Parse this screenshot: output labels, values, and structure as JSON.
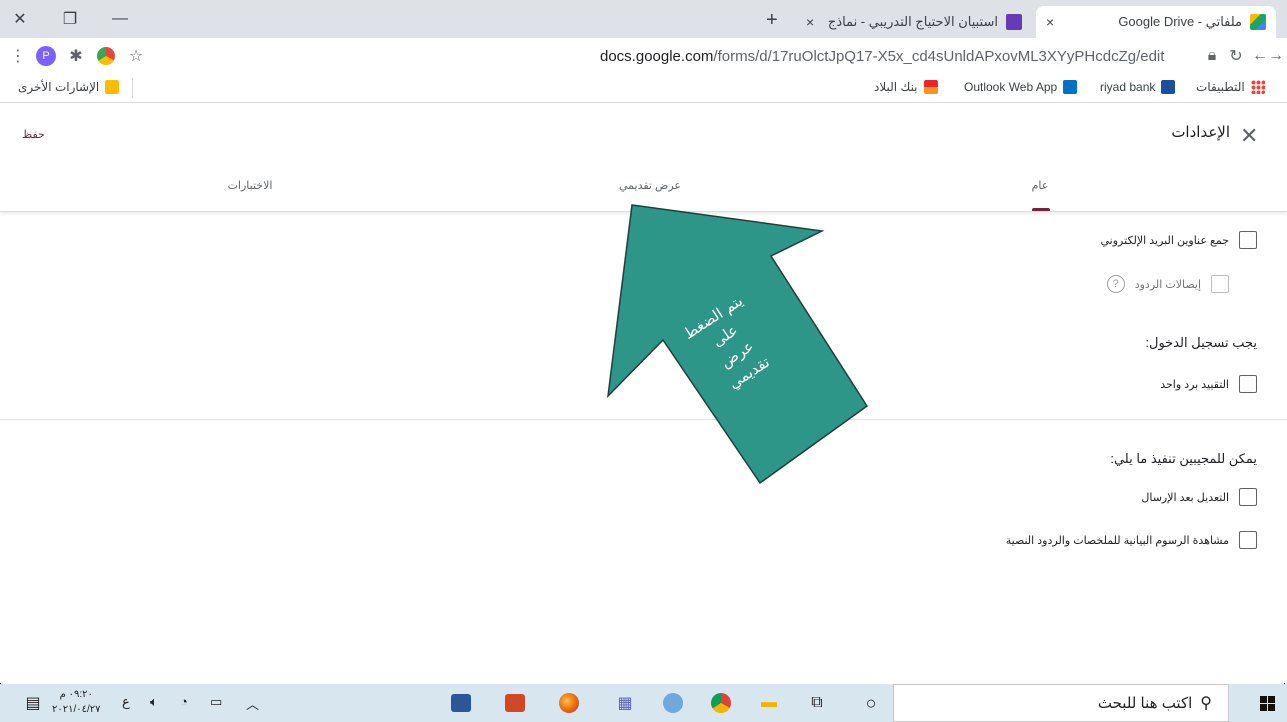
{
  "browser": {
    "tabs": [
      {
        "title": "ملفاتي - Google Drive",
        "close": "×",
        "favicon_color": "#1fa463"
      },
      {
        "title": "استبيان الاحتياج التدريبي - نماذج",
        "close": "×",
        "favicon_color": "#673ab7"
      }
    ],
    "new_tab": "+",
    "window_controls": {
      "close": "✕",
      "restore": "❐",
      "minimize": "—"
    },
    "url_host": "docs.google.com",
    "url_path": "/forms/d/17ruOlctJpQ17-X5x_cd4sUnldAPxovML3XYyPHcdcZg/edit",
    "avatar_letter": "P",
    "bookmarks": [
      {
        "label": "التطبيقات",
        "icon_color": "#e8453c"
      },
      {
        "label": "riyad bank",
        "icon_color": "#1a4f9c"
      },
      {
        "label": "Outlook Web App",
        "icon_color": "#0072c6"
      },
      {
        "label": "بنك البلاد",
        "icon_color": "#e8262c"
      }
    ],
    "other_bookmarks": "الإشارات الأخرى"
  },
  "settings": {
    "title": "الإعدادات",
    "save": "حفظ",
    "tabs": [
      "عام",
      "عرض تقديمي",
      "الاختبارات"
    ],
    "collect_email": "جمع عناوين البريد الإلكتروني",
    "response_receipts": "إيصالات الردود",
    "help_mark": "?",
    "requires_signin": "يجب تسجيل الدخول:",
    "limit_one": "التقييد برد واحد",
    "respondents_can": "يمكن للمجيبين تنفيذ ما يلي:",
    "edit_after": "التعديل بعد الإرسال",
    "see_charts": "مشاهدة الرسوم البيانية للملخصات والردود النصية"
  },
  "annotation": {
    "text_lines": [
      "يتم الضغط",
      "على",
      "عرض",
      "تقديمي"
    ],
    "color": "#2e9688"
  },
  "taskbar": {
    "search_placeholder": "اكتب هنا للبحث",
    "time": "٠٩:٢٠ م",
    "date": "٢٠٢١/٠٤/٢٧",
    "language": "ع"
  }
}
